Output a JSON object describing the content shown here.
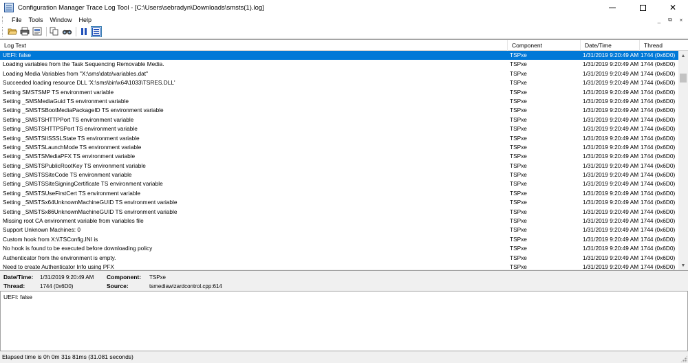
{
  "window": {
    "title": "Configuration Manager Trace Log Tool - [C:\\Users\\sebradyn\\Downloads\\smsts(1).log]",
    "min_glyph": "—",
    "close_glyph": "✕"
  },
  "menu": {
    "items": [
      "File",
      "Tools",
      "Window",
      "Help"
    ],
    "mdi": [
      "_",
      "⧉",
      "×"
    ]
  },
  "toolbar": {
    "buttons": [
      "open-icon",
      "print-icon",
      "print-preview-icon",
      "copy-icon",
      "find-icon",
      "pause-icon",
      "highlight-icon"
    ]
  },
  "columns": [
    "Log Text",
    "Component",
    "Date/Time",
    "Thread"
  ],
  "rows": [
    {
      "text": "UEFI: false",
      "component": "TSPxe",
      "datetime": "1/31/2019 9:20:49 AM",
      "thread": "1744 (0x6D0)",
      "selected": true
    },
    {
      "text": "Loading variables from the Task Sequencing Removable Media.",
      "component": "TSPxe",
      "datetime": "1/31/2019 9:20:49 AM",
      "thread": "1744 (0x6D0)"
    },
    {
      "text": "Loading Media Variables from \"X:\\sms\\data\\variables.dat\"",
      "component": "TSPxe",
      "datetime": "1/31/2019 9:20:49 AM",
      "thread": "1744 (0x6D0)"
    },
    {
      "text": "Succeeded loading resource DLL 'X:\\sms\\bin\\x64\\1033\\TSRES.DLL'",
      "component": "TSPxe",
      "datetime": "1/31/2019 9:20:49 AM",
      "thread": "1744 (0x6D0)"
    },
    {
      "text": "Setting SMSTSMP TS environment variable",
      "component": "TSPxe",
      "datetime": "1/31/2019 9:20:49 AM",
      "thread": "1744 (0x6D0)"
    },
    {
      "text": "Setting _SMSMediaGuid TS environment variable",
      "component": "TSPxe",
      "datetime": "1/31/2019 9:20:49 AM",
      "thread": "1744 (0x6D0)"
    },
    {
      "text": "Setting _SMSTSBootMediaPackageID TS environment variable",
      "component": "TSPxe",
      "datetime": "1/31/2019 9:20:49 AM",
      "thread": "1744 (0x6D0)"
    },
    {
      "text": "Setting _SMSTSHTTPPort TS environment variable",
      "component": "TSPxe",
      "datetime": "1/31/2019 9:20:49 AM",
      "thread": "1744 (0x6D0)"
    },
    {
      "text": "Setting _SMSTSHTTPSPort TS environment variable",
      "component": "TSPxe",
      "datetime": "1/31/2019 9:20:49 AM",
      "thread": "1744 (0x6D0)"
    },
    {
      "text": "Setting _SMSTSIISSSLState TS environment variable",
      "component": "TSPxe",
      "datetime": "1/31/2019 9:20:49 AM",
      "thread": "1744 (0x6D0)"
    },
    {
      "text": "Setting _SMSTSLaunchMode TS environment variable",
      "component": "TSPxe",
      "datetime": "1/31/2019 9:20:49 AM",
      "thread": "1744 (0x6D0)"
    },
    {
      "text": "Setting _SMSTSMediaPFX TS environment variable",
      "component": "TSPxe",
      "datetime": "1/31/2019 9:20:49 AM",
      "thread": "1744 (0x6D0)"
    },
    {
      "text": "Setting _SMSTSPublicRootKey TS environment variable",
      "component": "TSPxe",
      "datetime": "1/31/2019 9:20:49 AM",
      "thread": "1744 (0x6D0)"
    },
    {
      "text": "Setting _SMSTSSiteCode TS environment variable",
      "component": "TSPxe",
      "datetime": "1/31/2019 9:20:49 AM",
      "thread": "1744 (0x6D0)"
    },
    {
      "text": "Setting _SMSTSSiteSigningCertificate TS environment variable",
      "component": "TSPxe",
      "datetime": "1/31/2019 9:20:49 AM",
      "thread": "1744 (0x6D0)"
    },
    {
      "text": "Setting _SMSTSUseFirstCert TS environment variable",
      "component": "TSPxe",
      "datetime": "1/31/2019 9:20:49 AM",
      "thread": "1744 (0x6D0)"
    },
    {
      "text": "Setting _SMSTSx64UnknownMachineGUID TS environment variable",
      "component": "TSPxe",
      "datetime": "1/31/2019 9:20:49 AM",
      "thread": "1744 (0x6D0)"
    },
    {
      "text": "Setting _SMSTSx86UnknownMachineGUID TS environment variable",
      "component": "TSPxe",
      "datetime": "1/31/2019 9:20:49 AM",
      "thread": "1744 (0x6D0)"
    },
    {
      "text": "Missing root CA environment variable from variables file",
      "component": "TSPxe",
      "datetime": "1/31/2019 9:20:49 AM",
      "thread": "1744 (0x6D0)"
    },
    {
      "text": "Support Unknown Machines: 0",
      "component": "TSPxe",
      "datetime": "1/31/2019 9:20:49 AM",
      "thread": "1744 (0x6D0)"
    },
    {
      "text": "Custom hook from X:\\\\TSConfig.INI is",
      "component": "TSPxe",
      "datetime": "1/31/2019 9:20:49 AM",
      "thread": "1744 (0x6D0)"
    },
    {
      "text": "No hook is found to be executed before downloading policy",
      "component": "TSPxe",
      "datetime": "1/31/2019 9:20:49 AM",
      "thread": "1744 (0x6D0)"
    },
    {
      "text": "Authenticator from the environment is empty.",
      "component": "TSPxe",
      "datetime": "1/31/2019 9:20:49 AM",
      "thread": "1744 (0x6D0)"
    },
    {
      "text": "Need to create Authenticator Info using PFX",
      "component": "TSPxe",
      "datetime": "1/31/2019 9:20:49 AM",
      "thread": "1744 (0x6D0)"
    }
  ],
  "details": {
    "datetime_label": "Date/Time:",
    "datetime_value": "1/31/2019 9:20:49 AM",
    "component_label": "Component:",
    "component_value": "TSPxe",
    "thread_label": "Thread:",
    "thread_value": "1744 (0x6D0)",
    "source_label": "Source:",
    "source_value": "tsmediawizardcontrol.cpp:614"
  },
  "message": "UEFI: false",
  "status": "Elapsed time is 0h 0m 31s 81ms (31.081 seconds)",
  "colors": {
    "selection": "#0078d7"
  }
}
